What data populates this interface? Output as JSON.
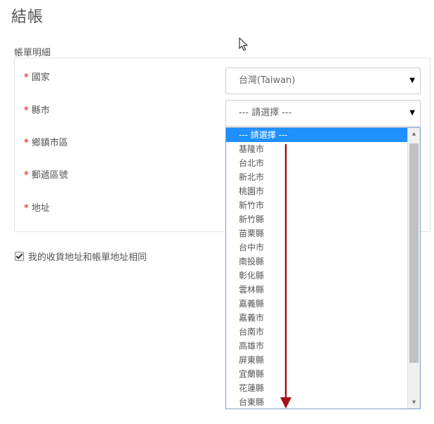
{
  "page": {
    "title": "結帳",
    "section_label": "帳單明細"
  },
  "form": {
    "required_marker": "*",
    "country": {
      "label": "國家",
      "value": "台灣(Taiwan)"
    },
    "county": {
      "label": "縣市",
      "value": "--- 請選擇 ---"
    },
    "district": {
      "label": "鄉鎮市區"
    },
    "postal_code": {
      "label": "郵遞區號"
    },
    "address": {
      "label": "地址"
    },
    "same_address_checkbox": {
      "label": "我的收貨地址和帳單地址相同",
      "checked": true
    }
  },
  "dropdown": {
    "options": [
      "--- 請選擇 ---",
      "基隆市",
      "台北市",
      "新北市",
      "桃園市",
      "新竹市",
      "新竹縣",
      "苗栗縣",
      "台中市",
      "南投縣",
      "彰化縣",
      "雲林縣",
      "嘉義縣",
      "嘉義市",
      "台南市",
      "高雄市",
      "屏東縣",
      "宜蘭縣",
      "花蓮縣",
      "台東縣"
    ],
    "selected_index": 0
  },
  "icons": {
    "select_arrow": "▼",
    "scroll_up": "▲",
    "scroll_down": "▼",
    "annotation_arrow": "down-arrow-icon",
    "cursor": "mouse-pointer-icon"
  },
  "colors": {
    "required": "#d9534f",
    "highlight": "#1e90ff",
    "annotation_arrow": "#a50f15"
  }
}
